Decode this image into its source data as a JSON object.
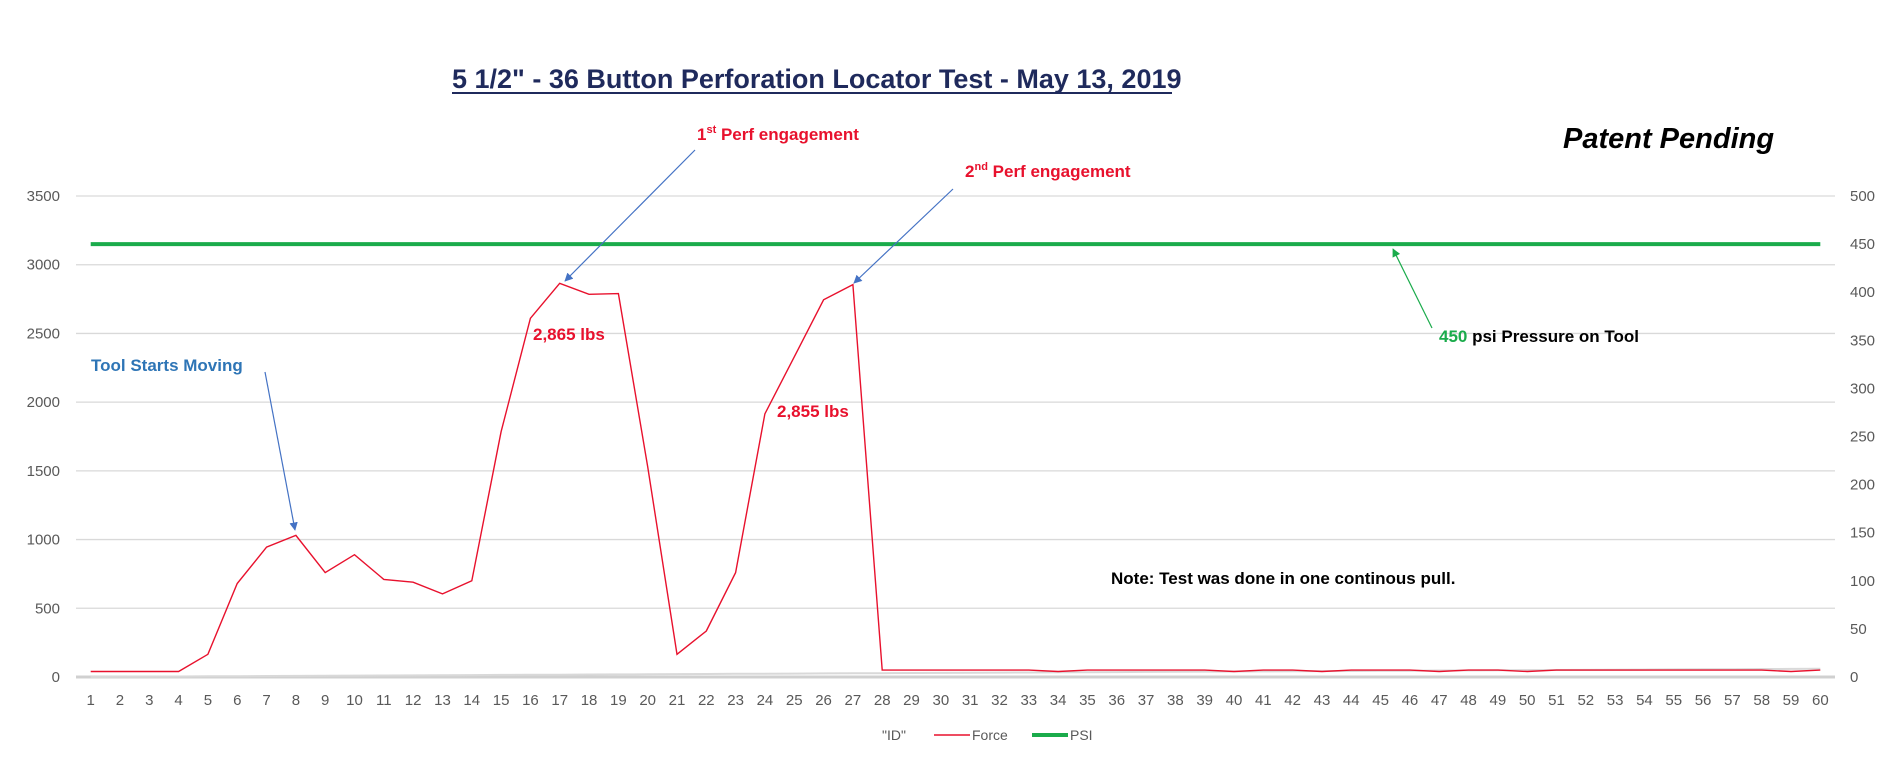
{
  "chart_data": {
    "type": "line",
    "title": "5 1/2\" - 36 Button Perforation Locator Test  - May 13, 2019",
    "watermark": "Patent Pending",
    "xlabel": "",
    "ylabel": "",
    "y2label": "",
    "categories": [
      "1",
      "2",
      "3",
      "4",
      "5",
      "6",
      "7",
      "8",
      "9",
      "10",
      "11",
      "12",
      "13",
      "14",
      "15",
      "16",
      "17",
      "18",
      "19",
      "20",
      "21",
      "22",
      "23",
      "24",
      "25",
      "26",
      "27",
      "28",
      "29",
      "30",
      "31",
      "32",
      "33",
      "34",
      "35",
      "36",
      "37",
      "38",
      "39",
      "40",
      "41",
      "42",
      "43",
      "44",
      "45",
      "46",
      "47",
      "48",
      "49",
      "50",
      "51",
      "52",
      "53",
      "54",
      "55",
      "56",
      "57",
      "58",
      "59",
      "60"
    ],
    "ylim": [
      0,
      3500
    ],
    "yticks": [
      0,
      500,
      1000,
      1500,
      2000,
      2500,
      3000,
      3500
    ],
    "y2lim": [
      0,
      500
    ],
    "y2ticks": [
      0,
      50,
      100,
      150,
      200,
      250,
      300,
      350,
      400,
      450,
      500
    ],
    "grid": true,
    "legend": "bottom",
    "series": [
      {
        "name": "\"ID\"",
        "axis": "left",
        "color": "#D9D9D9",
        "values": [
          1,
          2,
          3,
          4,
          5,
          6,
          7,
          8,
          9,
          10,
          11,
          12,
          13,
          14,
          15,
          16,
          17,
          18,
          19,
          20,
          21,
          22,
          23,
          24,
          25,
          26,
          27,
          28,
          29,
          30,
          31,
          32,
          33,
          34,
          35,
          36,
          37,
          38,
          39,
          40,
          41,
          42,
          43,
          44,
          45,
          46,
          47,
          48,
          49,
          50,
          51,
          52,
          53,
          54,
          55,
          56,
          57,
          58,
          59,
          60
        ]
      },
      {
        "name": "Force",
        "axis": "left",
        "color": "#E8112D",
        "values": [
          40,
          40,
          40,
          40,
          165,
          680,
          945,
          1030,
          760,
          890,
          710,
          690,
          605,
          700,
          1785,
          2610,
          2865,
          2785,
          2790,
          1530,
          165,
          335,
          760,
          1915,
          2330,
          2745,
          2855,
          50,
          50,
          50,
          50,
          50,
          50,
          40,
          50,
          50,
          50,
          50,
          50,
          40,
          50,
          50,
          40,
          50,
          50,
          50,
          40,
          50,
          50,
          40,
          50,
          50,
          50,
          50,
          50,
          50,
          50,
          50,
          40,
          50
        ]
      },
      {
        "name": "PSI",
        "axis": "right",
        "color": "#1AAB4B",
        "values": [
          450,
          450,
          450,
          450,
          450,
          450,
          450,
          450,
          450,
          450,
          450,
          450,
          450,
          450,
          450,
          450,
          450,
          450,
          450,
          450,
          450,
          450,
          450,
          450,
          450,
          450,
          450,
          450,
          450,
          450,
          450,
          450,
          450,
          450,
          450,
          450,
          450,
          450,
          450,
          450,
          450,
          450,
          450,
          450,
          450,
          450,
          450,
          450,
          450,
          450,
          450,
          450,
          450,
          450,
          450,
          450,
          450,
          450,
          450,
          450
        ]
      }
    ],
    "annotations": [
      {
        "id": "tool-starts",
        "text": "Tool Starts Moving",
        "color": "#2E75B6",
        "target_category": "8",
        "target_series": "Force"
      },
      {
        "id": "perf1",
        "text_main": "1",
        "text_sup": "st",
        "text_rest": " Perf engagement",
        "color": "#E8112D",
        "target_category": "17",
        "target_series": "Force"
      },
      {
        "id": "perf2",
        "text_main": "2",
        "text_sup": "nd",
        "text_rest": " Perf engagement",
        "color": "#E8112D",
        "target_category": "27",
        "target_series": "Force"
      },
      {
        "id": "peak1",
        "text": "2,865 lbs",
        "color": "#E8112D"
      },
      {
        "id": "peak2",
        "text": "2,855 lbs",
        "color": "#E8112D"
      },
      {
        "id": "psi",
        "text_value": "450",
        "text_rest": " psi Pressure on Tool",
        "value_color": "#1AAB4B",
        "color": "#000000",
        "target_category": "46",
        "target_series": "PSI"
      },
      {
        "id": "note",
        "text": "Note: Test was done in one continous pull.",
        "color": "#000000"
      }
    ]
  }
}
